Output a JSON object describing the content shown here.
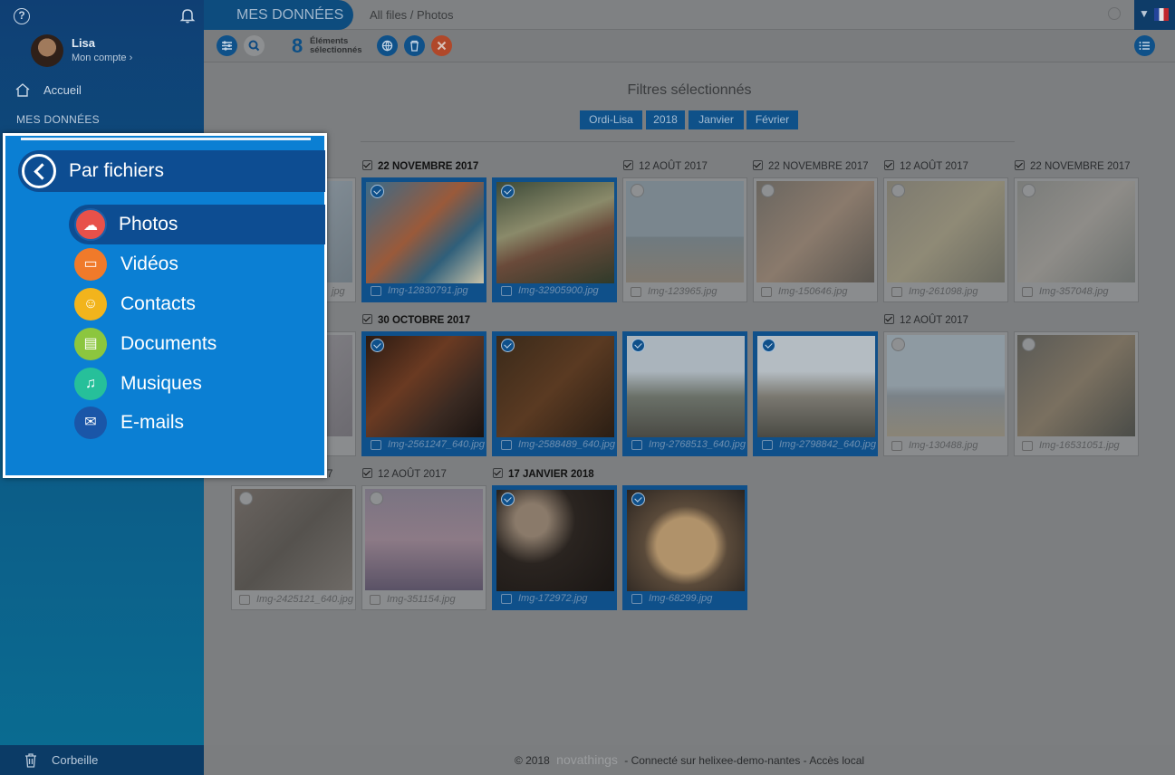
{
  "sidebar": {
    "help_icon": "?",
    "user": {
      "name": "Lisa",
      "account": "Mon compte ›"
    },
    "home": "Accueil",
    "section": "MES DONNÉES",
    "trash": "Corbeille"
  },
  "topbar": {
    "tab": "MES DONNÉES",
    "breadcrumb": "All files / Photos"
  },
  "toolbar": {
    "count": "8",
    "count_label_1": "Éléments",
    "count_label_2": "sélectionnés"
  },
  "filters": {
    "title": "Filtres sélectionnés",
    "chips": [
      "Ordi-Lisa",
      "2018",
      "Janvier",
      "Février"
    ]
  },
  "groups": {
    "r1": [
      {
        "label": "22 NOVEMBRE 2017",
        "sel": true
      },
      {
        "label": "12 AOÛT 2017",
        "sel": false
      },
      {
        "label": "22 NOVEMBRE 2017",
        "sel": false
      },
      {
        "label": "12 AOÛT 2017",
        "sel": false
      },
      {
        "label": "22 NOVEMBRE 2017",
        "sel": false
      }
    ],
    "r2": [
      {
        "label": "30 OCTOBRE 2017",
        "sel": true
      },
      {
        "label": "12 AOÛT 2017",
        "sel": false
      }
    ],
    "r3": [
      {
        "label": "7",
        "sel": false
      },
      {
        "label": "12 AOÛT 2017",
        "sel": false
      },
      {
        "label": "17 JANVIER 2018",
        "sel": true
      }
    ]
  },
  "photos": {
    "r1": [
      "jpg",
      "Img-12830791.jpg",
      "Img-32905900.jpg",
      "Img-123965.jpg",
      "Img-150646.jpg",
      "Img-261098.jpg",
      "Img-357048.jpg"
    ],
    "r2": [
      "",
      "Img-2561247_640.jpg",
      "Img-2588489_640.jpg",
      "Img-2768513_640.jpg",
      "Img-2798842_640.jpg",
      "Img-130488.jpg",
      "Img-16531051.jpg"
    ],
    "r3": [
      "Img-2425121_640.jpg",
      "Img-351154.jpg",
      "Img-172972.jpg",
      "Img-68299.jpg"
    ]
  },
  "footer": {
    "copy": "© 2018",
    "brand": "novathings",
    "text": "- Connecté sur helixee-demo-nantes - Accès local"
  },
  "popup": {
    "title": "Par fichiers",
    "items": [
      {
        "label": "Photos",
        "color": "#e8514a",
        "icon": "☁"
      },
      {
        "label": "Vidéos",
        "color": "#f07a2a",
        "icon": "▭"
      },
      {
        "label": "Contacts",
        "color": "#f2b41c",
        "icon": "☺"
      },
      {
        "label": "Documents",
        "color": "#8cc63e",
        "icon": "▤"
      },
      {
        "label": "Musiques",
        "color": "#26c09a",
        "icon": "♫"
      },
      {
        "label": "E-mails",
        "color": "#1a56a8",
        "icon": "✉"
      }
    ]
  }
}
